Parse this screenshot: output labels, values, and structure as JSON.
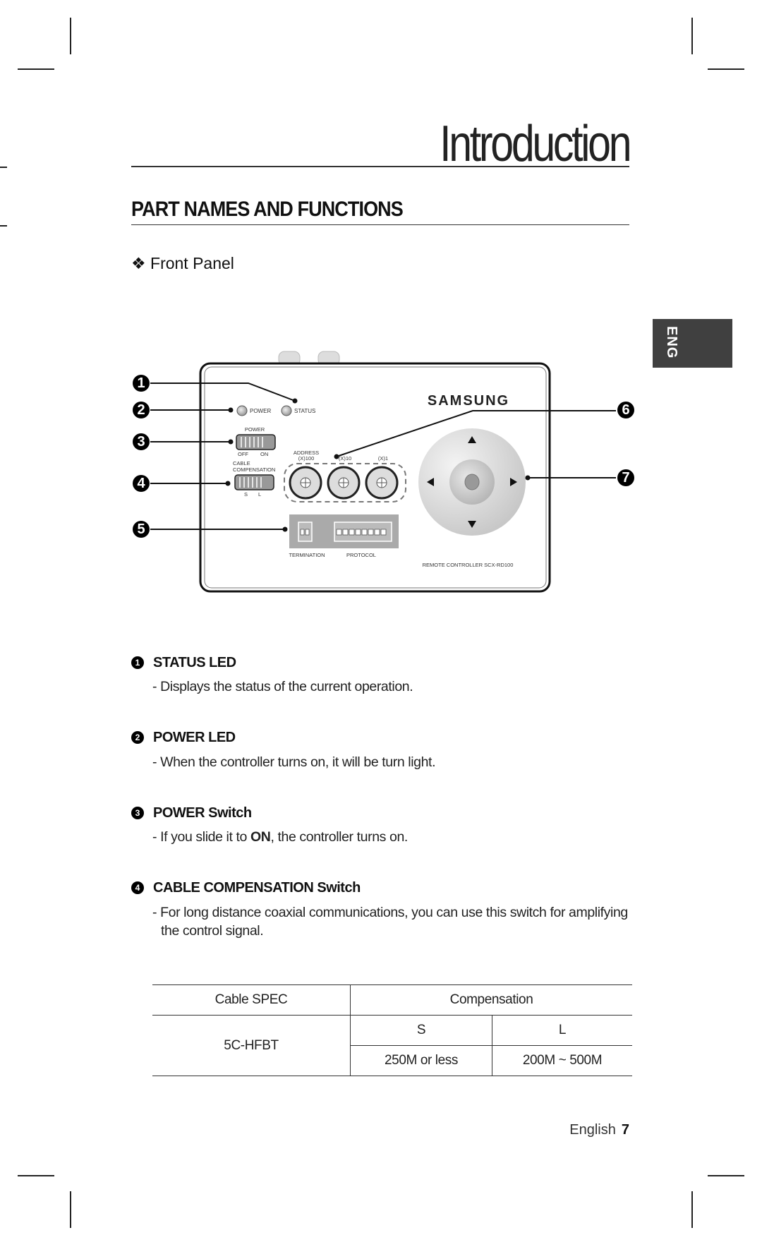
{
  "chapter_title": "Introduction",
  "section_title": "PART NAMES AND FUNCTIONS",
  "subsection": {
    "bullet": "❖",
    "title": "Front Panel"
  },
  "language_tab": "ENG",
  "diagram": {
    "brand": "SAMSUNG",
    "model_label": "REMOTE CONTROLLER SCX-RD100",
    "led_labels": [
      "POWER",
      "STATUS"
    ],
    "power_switch": {
      "label": "POWER",
      "off": "OFF",
      "on": "ON"
    },
    "cable_switch": {
      "label_line1": "CABLE",
      "label_line2": "COMPENSATION",
      "s": "S",
      "l": "L"
    },
    "address": {
      "label": "ADDRESS",
      "dials": [
        "(X)100",
        "(X)10",
        "(X)1"
      ]
    },
    "dip": {
      "termination": "TERMINATION",
      "protocol": "PROTOCOL"
    },
    "callouts": [
      "1",
      "2",
      "3",
      "4",
      "5",
      "6",
      "7"
    ]
  },
  "items": [
    {
      "num": "1",
      "title": "STATUS LED",
      "desc": "- Displays the status of the current operation."
    },
    {
      "num": "2",
      "title": "POWER LED",
      "desc": "- When the controller turns on, it will be turn light."
    },
    {
      "num": "3",
      "title": "POWER Switch",
      "desc_pre": "- If you slide it to ",
      "desc_bold": "ON",
      "desc_post": ", the controller turns on."
    },
    {
      "num": "4",
      "title": "CABLE COMPENSATION Switch",
      "desc_line1": "- For long distance coaxial communications, you can use this switch for amplifying",
      "desc_line2": "the control signal."
    }
  ],
  "table": {
    "header": [
      "Cable SPEC",
      "Compensation"
    ],
    "cable": "5C-HFBT",
    "modes": [
      "S",
      "L"
    ],
    "ranges": [
      "250M or less",
      "200M ~ 500M"
    ]
  },
  "footer": {
    "language": "English",
    "page": "7"
  }
}
